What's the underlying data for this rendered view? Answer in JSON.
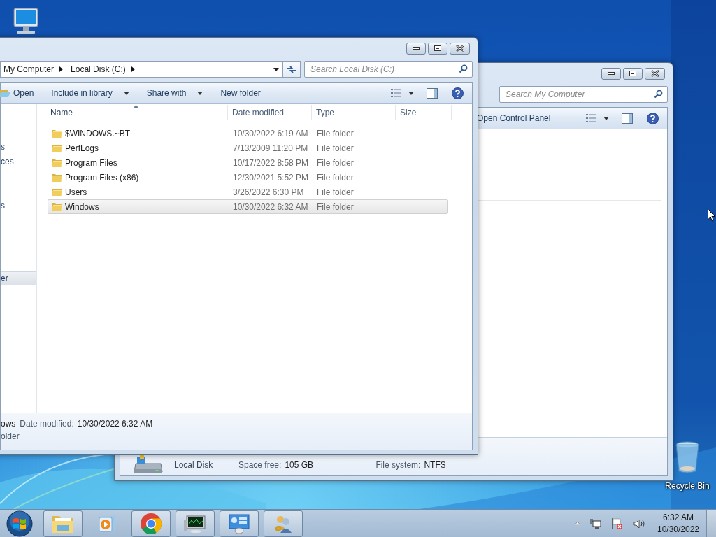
{
  "desktop": {
    "icons": [
      {
        "kind": "computer"
      },
      {
        "kind": "recycle_bin",
        "label": "Recycle Bin"
      }
    ]
  },
  "back_window": {
    "search": {
      "placeholder": "Search My Computer"
    },
    "toolbar": [
      {
        "label": "Open Control Panel"
      }
    ],
    "details": {
      "name": "Local Disk",
      "fields": [
        {
          "label": "Space free:",
          "value": "105 GB"
        },
        {
          "label": "File system:",
          "value": "NTFS"
        }
      ]
    }
  },
  "front_window": {
    "address": [
      "My Computer",
      "Local Disk (C:)"
    ],
    "search": {
      "placeholder": "Search Local Disk (C:)"
    },
    "toolbar": [
      {
        "kind": "open",
        "label": "Open"
      },
      {
        "kind": "menu",
        "label": "Include in library"
      },
      {
        "kind": "menu",
        "label": "Share with"
      },
      {
        "kind": "plain",
        "label": "New folder"
      }
    ],
    "sidebar": [
      {
        "items": [
          {
            "label": "s",
            "selected": false
          },
          {
            "label": "ces",
            "selected": false
          }
        ]
      },
      {
        "items": [
          {
            "label": "s",
            "selected": false
          }
        ]
      },
      {
        "items": [
          {
            "label": "er",
            "selected": true
          }
        ]
      }
    ],
    "columns": [
      {
        "label": "Name",
        "sorted": true
      },
      {
        "label": "Date modified",
        "sorted": false
      },
      {
        "label": "Type",
        "sorted": false
      },
      {
        "label": "Size",
        "sorted": false
      }
    ],
    "rows": [
      {
        "name": "$WINDOWS.~BT",
        "date": "10/30/2022 6:19 AM",
        "type": "File folder",
        "selected": false
      },
      {
        "name": "PerfLogs",
        "date": "7/13/2009 11:20 PM",
        "type": "File folder",
        "selected": false
      },
      {
        "name": "Program Files",
        "date": "10/17/2022 8:58 PM",
        "type": "File folder",
        "selected": false
      },
      {
        "name": "Program Files (x86)",
        "date": "12/30/2021 5:52 PM",
        "type": "File folder",
        "selected": false
      },
      {
        "name": "Users",
        "date": "3/26/2022 6:30 PM",
        "type": "File folder",
        "selected": false
      },
      {
        "name": "Windows",
        "date": "10/30/2022 6:32 AM",
        "type": "File folder",
        "selected": true
      }
    ],
    "details": {
      "name": "ows",
      "fields": [
        {
          "label": "Date modified:",
          "value": "10/30/2022 6:32 AM"
        }
      ],
      "type": "older"
    }
  },
  "taskbar": {
    "buttons": [
      {
        "kind": "explorer",
        "running": true
      },
      {
        "kind": "media",
        "running": false
      },
      {
        "kind": "chrome",
        "running": true
      },
      {
        "kind": "monitor",
        "running": true
      },
      {
        "kind": "control_panel",
        "running": true
      },
      {
        "kind": "users",
        "running": true
      }
    ],
    "tray": {
      "time": "6:32 AM",
      "date": "10/30/2022"
    }
  }
}
